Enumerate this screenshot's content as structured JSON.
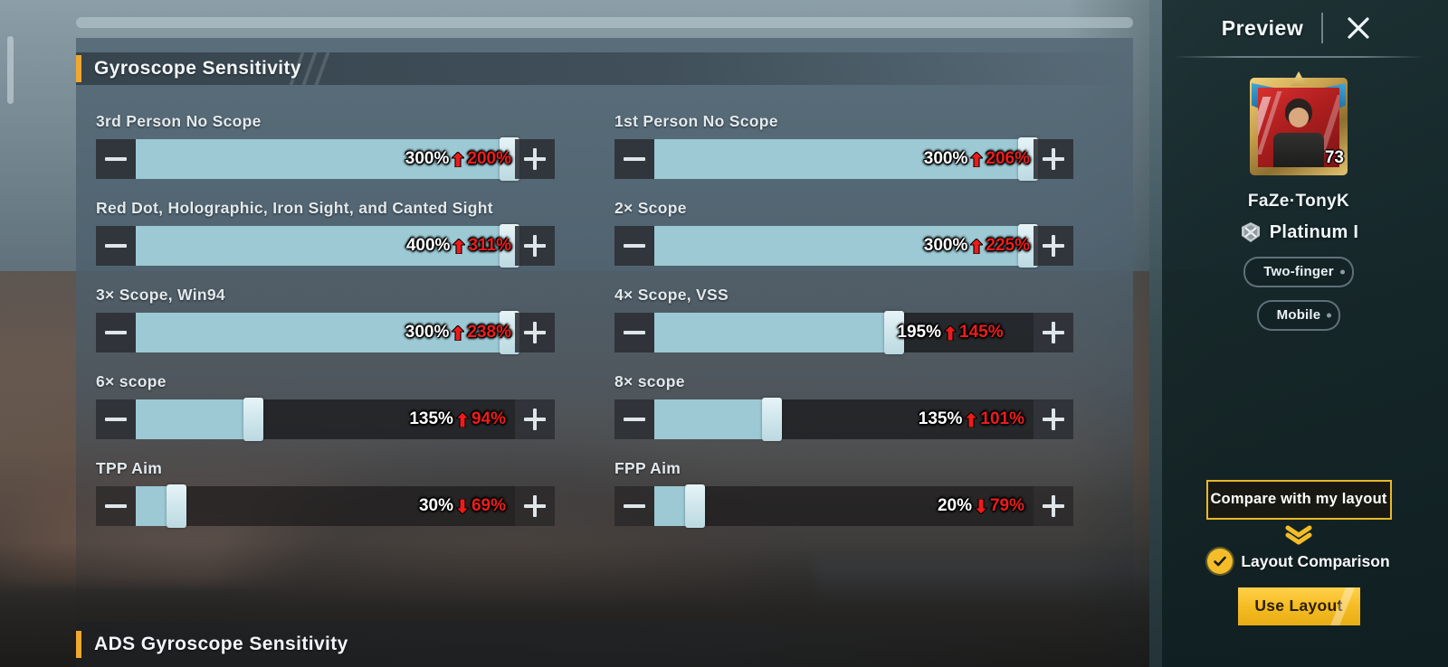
{
  "section": {
    "title": "Gyroscope Sensitivity",
    "next_title": "ADS Gyroscope Sensitivity"
  },
  "sliders": [
    {
      "label": "3rd Person No Scope",
      "value": "300%",
      "delta": "200%",
      "direction": "up",
      "fill_pct": 100,
      "text_pos": "inside"
    },
    {
      "label": "1st Person No Scope",
      "value": "300%",
      "delta": "206%",
      "direction": "up",
      "fill_pct": 100,
      "text_pos": "inside"
    },
    {
      "label": "Red Dot, Holographic, Iron Sight, and Canted Sight",
      "value": "400%",
      "delta": "311%",
      "direction": "up",
      "fill_pct": 100,
      "text_pos": "inside"
    },
    {
      "label": "2× Scope",
      "value": "300%",
      "delta": "225%",
      "direction": "up",
      "fill_pct": 100,
      "text_pos": "inside"
    },
    {
      "label": "3× Scope, Win94",
      "value": "300%",
      "delta": "238%",
      "direction": "up",
      "fill_pct": 100,
      "text_pos": "inside"
    },
    {
      "label": "4× Scope, VSS",
      "value": "195%",
      "delta": "145%",
      "direction": "up",
      "fill_pct": 60,
      "text_pos": "after"
    },
    {
      "label": "6× scope",
      "value": "135%",
      "delta": "94%",
      "direction": "up",
      "fill_pct": 28,
      "text_pos": "right"
    },
    {
      "label": "8× scope",
      "value": "135%",
      "delta": "101%",
      "direction": "up",
      "fill_pct": 28,
      "text_pos": "right"
    },
    {
      "label": "TPP Aim",
      "value": "30%",
      "delta": "69%",
      "direction": "down",
      "fill_pct": 8,
      "text_pos": "right"
    },
    {
      "label": "FPP Aim",
      "value": "20%",
      "delta": "79%",
      "direction": "down",
      "fill_pct": 8,
      "text_pos": "right"
    }
  ],
  "stepper": {
    "minus_label": "−",
    "plus_label": "+"
  },
  "sidebar": {
    "title": "Preview",
    "close_label": "✕",
    "player_name": "FaZe·TonyK",
    "rank": "Platinum I",
    "level": "73",
    "tags": [
      "Two-finger",
      "Mobile"
    ],
    "compare_button": "Compare with my layout",
    "comparison_label": "Layout Comparison",
    "use_button": "Use Layout"
  },
  "colors": {
    "accent_gold": "#f3bd2a",
    "section_bar": "#f0a830",
    "slider_fill": "#9cc9d4",
    "delta_red": "#f01c1c"
  }
}
